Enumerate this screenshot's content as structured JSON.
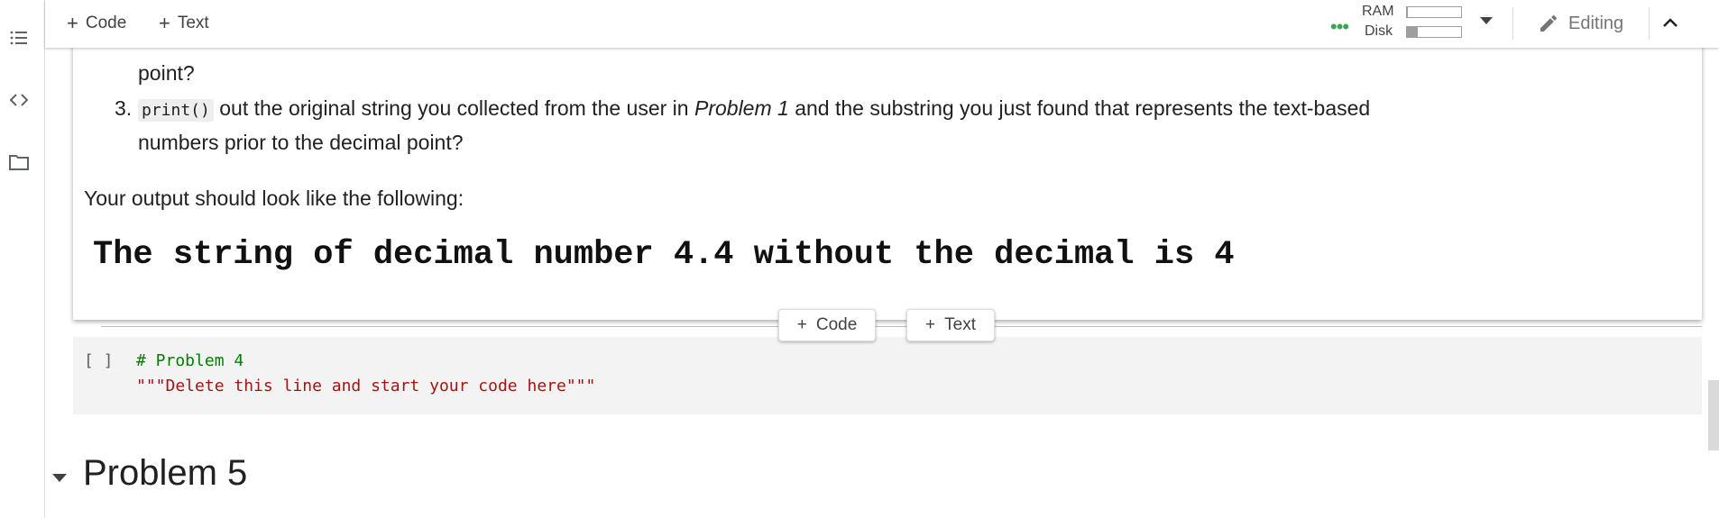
{
  "left_rail": {
    "icons": [
      "table-of-contents-icon",
      "code-snippets-icon",
      "files-folder-icon"
    ]
  },
  "toolbar": {
    "add_code_label": "Code",
    "add_text_label": "Text",
    "ram_label": "RAM",
    "disk_label": "Disk",
    "ram_usage": 0.02,
    "disk_usage": 0.2,
    "editing_label": "Editing",
    "colors": {
      "connected_dots": "#34a853"
    }
  },
  "text_cell": {
    "item2_tail": "point?",
    "item3": {
      "number": "3.",
      "code": "print()",
      "text_a": " out the original string you collected from the user in ",
      "emph": "Problem 1",
      "text_b": " and the substring you just found that represents the text-based",
      "line2": "numbers prior to the decimal point?"
    },
    "output_intro": "Your output should look like the following:",
    "example_output": "The string of decimal number 4.4 without the decimal is 4"
  },
  "insert_buttons": {
    "code_label": "Code",
    "text_label": "Text"
  },
  "code_cell": {
    "run_indicator": "[ ]",
    "line1": "# Problem 4",
    "line2": "\"\"\"Delete this line and start your code here\"\"\"",
    "colors": {
      "comment": "#008000",
      "string": "#a31515"
    }
  },
  "section": {
    "title": "Problem 5"
  }
}
